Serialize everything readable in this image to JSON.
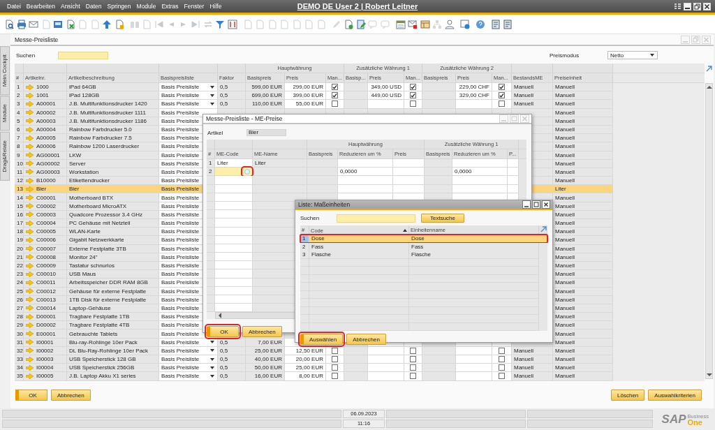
{
  "menu": [
    "Datei",
    "Bearbeiten",
    "Ansicht",
    "Daten",
    "Springen",
    "Module",
    "Extras",
    "Fenster",
    "Hilfe"
  ],
  "app_title": "DEMO DE User 2 | Robert Leitner",
  "side_tabs": [
    "Mein Cockpit",
    "Module",
    "Drag&Relate"
  ],
  "window": {
    "title": "Messe-Preisliste",
    "search_label": "Suchen",
    "price_mode_label": "Preismodus",
    "price_mode": "Netto"
  },
  "table": {
    "column_groups": [
      {
        "columns": [
          "#",
          "Artikelnr.",
          "Artikelbeschreibung",
          "Basispreisliste",
          "Faktor"
        ]
      },
      {
        "label": "Hauptwährung",
        "columns": [
          "Basispreis",
          "Preis",
          "Man..."
        ]
      },
      {
        "label": "Zusätzliche Währung 1",
        "columns": [
          "Basisp...",
          "Preis",
          "Man..."
        ]
      },
      {
        "label": "Zusätzliche Währung 2",
        "columns": [
          "Basispreis",
          "Preis",
          "Man..."
        ]
      },
      {
        "columns": [
          "BestandsME",
          "Preiseinheit"
        ]
      }
    ],
    "rows": [
      {
        "n": "1",
        "code": "1000",
        "desc": "iPad 64GB",
        "base": "Basis Preisliste",
        "factor": "0,5",
        "base_price": "599,00 EUR",
        "price": "299,00 EUR",
        "manual": true,
        "z1_price": "349,00 USD",
        "z1_manual": true,
        "z2_price": "229,00 CHF",
        "z2_manual": true,
        "stock_uom": "Manuell",
        "price_unit": "Manuell",
        "selected": false
      },
      {
        "n": "2",
        "code": "1001",
        "desc": "iPad 128GB",
        "base": "Basis Preisliste",
        "factor": "0,5",
        "base_price": "699,00 EUR",
        "price": "399,00 EUR",
        "manual": true,
        "z1_price": "449,00 USD",
        "z1_manual": true,
        "z2_price": "329,00 CHF",
        "z2_manual": true,
        "stock_uom": "Manuell",
        "price_unit": "Manuell",
        "selected": false
      },
      {
        "n": "3",
        "code": "A00001",
        "desc": "J.B. Multifunktionsdrucker 1420",
        "base": "Basis Preisliste",
        "factor": "0,5",
        "base_price": "110,00 EUR",
        "price": "55,00 EUR",
        "manual": false,
        "z1_manual": false,
        "z2_manual": false,
        "stock_uom": "Manuell",
        "price_unit": "Manuell",
        "selected": false
      },
      {
        "n": "4",
        "code": "A00002",
        "desc": "J.B. Multifunktionsdrucker 1111",
        "base": "Basis Preisliste",
        "price_unit": "Manuell",
        "selected": false
      },
      {
        "n": "5",
        "code": "A00003",
        "desc": "J.B. Multifunktionsdrucker 1186",
        "base": "Basis Preisliste",
        "price_unit": "Manuell",
        "selected": false
      },
      {
        "n": "6",
        "code": "A00004",
        "desc": "Rainbow Farbdrucker 5.0",
        "base": "Basis Preisliste",
        "price_unit": "Manuell",
        "selected": false
      },
      {
        "n": "7",
        "code": "A00005",
        "desc": "Rainbow Farbdrucker 7.5",
        "base": "Basis Preisliste",
        "price_unit": "Manuell",
        "selected": false
      },
      {
        "n": "8",
        "code": "A00006",
        "desc": "Rainbow 1200 Laserdrucker",
        "base": "Basis Preisliste",
        "price_unit": "Manuell",
        "selected": false
      },
      {
        "n": "9",
        "code": "AG00001",
        "desc": "LKW",
        "base": "Basis Preisliste",
        "price_unit": "Manuell",
        "selected": false
      },
      {
        "n": "10",
        "code": "AG00002",
        "desc": "Server",
        "base": "Basis Preisliste",
        "price_unit": "Manuell",
        "selected": false
      },
      {
        "n": "11",
        "code": "AG00003",
        "desc": "Workstation",
        "base": "Basis Preisliste",
        "price_unit": "Manuell",
        "selected": false
      },
      {
        "n": "12",
        "code": "B10000",
        "desc": "Etikettendrucker",
        "base": "Basis Preisliste",
        "price_unit": "Manuell",
        "selected": false
      },
      {
        "n": "13",
        "code": "Bier",
        "desc": "Bier",
        "base": "Basis Preisliste",
        "price_unit": "Liter",
        "selected": true
      },
      {
        "n": "14",
        "code": "C00001",
        "desc": "Motherboard BTX",
        "base": "Basis Preisliste",
        "price_unit": "Manuell",
        "selected": false
      },
      {
        "n": "15",
        "code": "C00002",
        "desc": "Motherboard MicroATX",
        "base": "Basis Preisliste",
        "price_unit": "Manuell",
        "selected": false
      },
      {
        "n": "16",
        "code": "C00003",
        "desc": "Quadcore Prozessor 3.4 GHz",
        "base": "Basis Preisliste",
        "price_unit": "Manuell",
        "selected": false
      },
      {
        "n": "17",
        "code": "C00004",
        "desc": "PC Gehäuse mit Netzteil",
        "base": "Basis Preisliste",
        "price_unit": "Manuell",
        "selected": false
      },
      {
        "n": "18",
        "code": "C00005",
        "desc": "WLAN-Karte",
        "base": "Basis Preisliste",
        "price_unit": "Manuell",
        "selected": false
      },
      {
        "n": "19",
        "code": "C00006",
        "desc": "Gigabit Netzwerkkarte",
        "base": "Basis Preisliste",
        "price_unit": "Manuell",
        "selected": false
      },
      {
        "n": "20",
        "code": "C00007",
        "desc": "Externe Festplatte 3TB",
        "base": "Basis Preisliste",
        "price_unit": "Manuell",
        "selected": false
      },
      {
        "n": "21",
        "code": "C00008",
        "desc": "Monitor 24\"",
        "base": "Basis Preisliste",
        "price_unit": "Manuell",
        "selected": false
      },
      {
        "n": "22",
        "code": "C00009",
        "desc": "Tastatur schnurlos",
        "base": "Basis Preisliste",
        "price_unit": "Manuell",
        "selected": false
      },
      {
        "n": "23",
        "code": "C00010",
        "desc": "USB Maus",
        "base": "Basis Preisliste",
        "price_unit": "Manuell",
        "selected": false
      },
      {
        "n": "24",
        "code": "C00011",
        "desc": "Arbeitsspeicher DDR RAM 8GB",
        "base": "Basis Preisliste",
        "price_unit": "Manuell",
        "selected": false
      },
      {
        "n": "25",
        "code": "C00012",
        "desc": "Gehäuse für externe Festplatte",
        "base": "Basis Preisliste",
        "price_unit": "Manuell",
        "selected": false
      },
      {
        "n": "26",
        "code": "C00013",
        "desc": "1TB Disk für externe Festplatte",
        "base": "Basis Preisliste",
        "price_unit": "Manuell",
        "selected": false
      },
      {
        "n": "27",
        "code": "C00014",
        "desc": "Laptop-Gehäuse",
        "base": "Basis Preisliste",
        "price_unit": "Manuell",
        "selected": false
      },
      {
        "n": "28",
        "code": "D00001",
        "desc": "Tragbare Festplatte 1TB",
        "base": "Basis Preisliste",
        "price_unit": "Manuell",
        "selected": false
      },
      {
        "n": "29",
        "code": "D00002",
        "desc": "Tragbare Festplatte 4TB",
        "base": "Basis Preisliste",
        "price_unit": "Manuell",
        "selected": false
      },
      {
        "n": "30",
        "code": "E00001",
        "desc": "Gebrauchte Tablets",
        "base": "Basis Preisliste",
        "price_unit": "Manuell",
        "selected": false
      },
      {
        "n": "31",
        "code": "I00001",
        "desc": "Blu-ray-Rohlinge 10er Pack",
        "base": "Basis Preisliste",
        "factor": "0,5",
        "base_price": "7,00 EUR",
        "price_unit": "Manuell",
        "selected": false
      },
      {
        "n": "32",
        "code": "I00002",
        "desc": "DL Blu-Ray-Rohlinge 10er Pack",
        "base": "Basis Preisliste",
        "factor": "0,5",
        "base_price": "25,00 EUR",
        "price": "12,50 EUR",
        "manual": false,
        "z1_manual": false,
        "z2_manual": false,
        "stock_uom": "Manuell",
        "price_unit": "Manuell",
        "selected": false
      },
      {
        "n": "33",
        "code": "I00003",
        "desc": "USB Speicherstick 128 GB",
        "base": "Basis Preisliste",
        "factor": "0,5",
        "base_price": "40,00 EUR",
        "price": "20,00 EUR",
        "manual": false,
        "z1_manual": false,
        "z2_manual": false,
        "stock_uom": "Manuell",
        "price_unit": "Manuell",
        "selected": false
      },
      {
        "n": "34",
        "code": "I00004",
        "desc": "USB Speicherstick 256GB",
        "base": "Basis Preisliste",
        "factor": "0,5",
        "base_price": "50,00 EUR",
        "price": "25,00 EUR",
        "manual": false,
        "z1_manual": false,
        "z2_manual": false,
        "stock_uom": "Manuell",
        "price_unit": "Manuell",
        "selected": false
      },
      {
        "n": "35",
        "code": "I00005",
        "desc": "J.B. Laptop Akku X1 series",
        "base": "Basis Preisliste",
        "factor": "0,5",
        "base_price": "16,00 EUR",
        "price": "8,00 EUR",
        "manual": false,
        "z1_manual": false,
        "z2_manual": false,
        "stock_uom": "Manuell",
        "price_unit": "Manuell",
        "selected": false
      }
    ]
  },
  "buttons_left": [
    {
      "label": "OK",
      "default": true
    },
    {
      "label": "Abbrechen",
      "default": false
    }
  ],
  "buttons_right": [
    {
      "label": "Löschen",
      "default": false
    },
    {
      "label": "Auswahlkriterien",
      "default": false
    }
  ],
  "status_bar": {
    "date": "06.09.2023",
    "time": "11:16"
  },
  "logo": {
    "name": "SAP",
    "line1": "Business",
    "line2": "One"
  },
  "price_dialog": {
    "title": "Messe-Preisliste - ME-Preise",
    "article_label": "Artikel",
    "article": "Bier",
    "column_groups": [
      {
        "columns": [
          "#",
          "ME-Code",
          "ME-Name"
        ]
      },
      {
        "label": "Hauptwährung",
        "columns": [
          "Basispreis",
          "Reduzieren um %",
          "Preis"
        ]
      },
      {
        "label": "Zusätzliche Währung 1",
        "columns": [
          "Basispreis",
          "Reduzieren um %",
          "P..."
        ]
      }
    ],
    "rows": [
      {
        "n": "1",
        "code": "Liter",
        "name": "Liter",
        "editing": false
      },
      {
        "n": "2",
        "editing": true,
        "lookup_highlighted": true,
        "reduce": "0,0000",
        "z1_reduce": "0,0000"
      }
    ],
    "buttons": [
      {
        "label": "OK",
        "default": true,
        "highlighted": true
      },
      {
        "label": "Abbrechen",
        "default": false,
        "highlighted": false
      }
    ]
  },
  "units_dialog": {
    "title": "Liste: Maßeinheiten",
    "search_label": "Suchen",
    "search_button": "Textsuche",
    "columns": [
      "#",
      "Code",
      "Einheitenname"
    ],
    "rows": [
      {
        "n": "1",
        "code": "Dose",
        "name": "Dose",
        "selected": true,
        "highlighted": true
      },
      {
        "n": "2",
        "code": "Fass",
        "name": "Fass",
        "selected": false,
        "highlighted": false
      },
      {
        "n": "3",
        "code": "Flasche",
        "name": "Flasche",
        "selected": false,
        "highlighted": false
      }
    ],
    "buttons": [
      {
        "label": "Auswählen",
        "default": true,
        "highlighted": true
      },
      {
        "label": "Abbrechen",
        "default": false,
        "highlighted": false
      }
    ]
  }
}
